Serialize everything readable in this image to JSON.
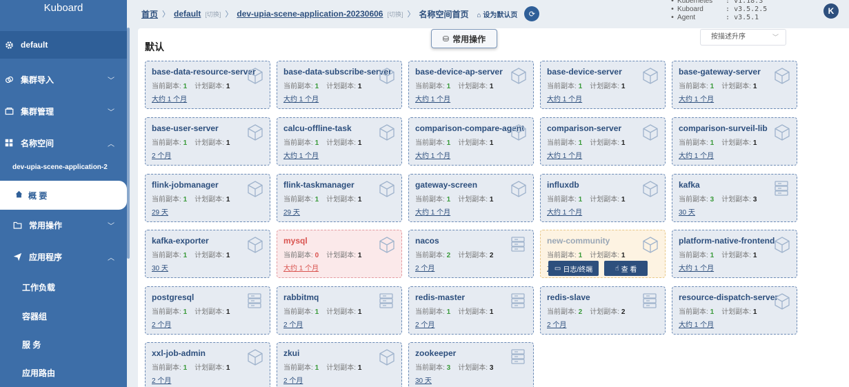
{
  "sidebar": {
    "logo": "Kuboard",
    "items": [
      {
        "label": "default",
        "icon": "gear-icon"
      },
      {
        "label": "集群导入",
        "icon": "link-icon"
      },
      {
        "label": "集群管理",
        "icon": "folder-icon"
      },
      {
        "label": "名称空间",
        "icon": "grid-icon"
      },
      {
        "label": "常用操作",
        "icon": "folder-icon"
      },
      {
        "label": "应用程序",
        "icon": "send-icon"
      }
    ],
    "namespace": "dev-upia-scene-application-2",
    "active": "概 要",
    "subitems": [
      "工作负载",
      "容器组",
      "服 务",
      "应用路由"
    ]
  },
  "topbar": {
    "breadcrumb": {
      "home": "首页",
      "cluster": "default",
      "switch": "[切换]",
      "namespace": "dev-upia-scene-application-20230606",
      "current": "名称空间首页",
      "set_default": "设为默认页"
    },
    "versions": [
      {
        "key": "Kubernetes",
        "val": ": v1.18.3"
      },
      {
        "key": "Kuboard",
        "val": ": v3.5.2.5"
      },
      {
        "key": "Agent",
        "val": ": v3.5.1"
      }
    ],
    "avatar": "K"
  },
  "main": {
    "section_title": "默认",
    "common_ops": "常用操作",
    "sort": "按描述升序",
    "current_label": "当前副本:",
    "plan_label": "计划副本:",
    "overlay": {
      "logs": "日志/终端",
      "view": "查 看"
    }
  },
  "workloads": [
    {
      "name": "base-data-resource-server",
      "cur": "1",
      "plan": "1",
      "age": "大约 1 个月",
      "icon": "cube"
    },
    {
      "name": "base-data-subscribe-server",
      "cur": "1",
      "plan": "1",
      "age": "大约 1 个月",
      "icon": "cube"
    },
    {
      "name": "base-device-ap-server",
      "cur": "1",
      "plan": "1",
      "age": "大约 1 个月",
      "icon": "cube"
    },
    {
      "name": "base-device-server",
      "cur": "1",
      "plan": "1",
      "age": "大约 1 个月",
      "icon": "cube"
    },
    {
      "name": "base-gateway-server",
      "cur": "1",
      "plan": "1",
      "age": "大约 1 个月",
      "icon": "cube"
    },
    {
      "name": "base-user-server",
      "cur": "1",
      "plan": "1",
      "age": "2 个月",
      "icon": "cube"
    },
    {
      "name": "calcu-offline-task",
      "cur": "1",
      "plan": "1",
      "age": "大约 1 个月",
      "icon": "cube"
    },
    {
      "name": "comparison-compare-agent",
      "cur": "1",
      "plan": "1",
      "age": "大约 1 个月",
      "icon": "cube"
    },
    {
      "name": "comparison-server",
      "cur": "1",
      "plan": "1",
      "age": "大约 1 个月",
      "icon": "cube"
    },
    {
      "name": "comparison-surveil-lib",
      "cur": "1",
      "plan": "1",
      "age": "大约 1 个月",
      "icon": "cube"
    },
    {
      "name": "flink-jobmanager",
      "cur": "1",
      "plan": "1",
      "age": "29 天",
      "icon": "cube"
    },
    {
      "name": "flink-taskmanager",
      "cur": "1",
      "plan": "1",
      "age": "29 天",
      "icon": "cube"
    },
    {
      "name": "gateway-screen",
      "cur": "1",
      "plan": "1",
      "age": "大约 1 个月",
      "icon": "cube"
    },
    {
      "name": "influxdb",
      "cur": "1",
      "plan": "1",
      "age": "大约 1 个月",
      "icon": "cube"
    },
    {
      "name": "kafka",
      "cur": "3",
      "plan": "3",
      "age": "30 天",
      "icon": "db"
    },
    {
      "name": "kafka-exporter",
      "cur": "1",
      "plan": "1",
      "age": "30 天",
      "icon": "cube"
    },
    {
      "name": "mysql",
      "cur": "0",
      "plan": "1",
      "age": "大约 1 个月",
      "icon": "cube",
      "status": "err"
    },
    {
      "name": "nacos",
      "cur": "2",
      "plan": "2",
      "age": "2 个月",
      "icon": "db"
    },
    {
      "name": "new-community",
      "cur": "1",
      "plan": "1",
      "age": "大",
      "icon": "cube",
      "status": "warn"
    },
    {
      "name": "platform-native-frontend",
      "cur": "1",
      "plan": "1",
      "age": "大约 1 个月",
      "icon": "cube"
    },
    {
      "name": "postgresql",
      "cur": "1",
      "plan": "1",
      "age": "2 个月",
      "icon": "db"
    },
    {
      "name": "rabbitmq",
      "cur": "1",
      "plan": "1",
      "age": "2 个月",
      "icon": "db"
    },
    {
      "name": "redis-master",
      "cur": "1",
      "plan": "1",
      "age": "2 个月",
      "icon": "db"
    },
    {
      "name": "redis-slave",
      "cur": "2",
      "plan": "2",
      "age": "2 个月",
      "icon": "db"
    },
    {
      "name": "resource-dispatch-server",
      "cur": "1",
      "plan": "1",
      "age": "大约 1 个月",
      "icon": "cube"
    },
    {
      "name": "xxl-job-admin",
      "cur": "1",
      "plan": "1",
      "age": "2 个月",
      "icon": "cube"
    },
    {
      "name": "zkui",
      "cur": "1",
      "plan": "1",
      "age": "2 个月",
      "icon": "cube"
    },
    {
      "name": "zookeeper",
      "cur": "3",
      "plan": "3",
      "age": "30 天",
      "icon": "db"
    }
  ]
}
